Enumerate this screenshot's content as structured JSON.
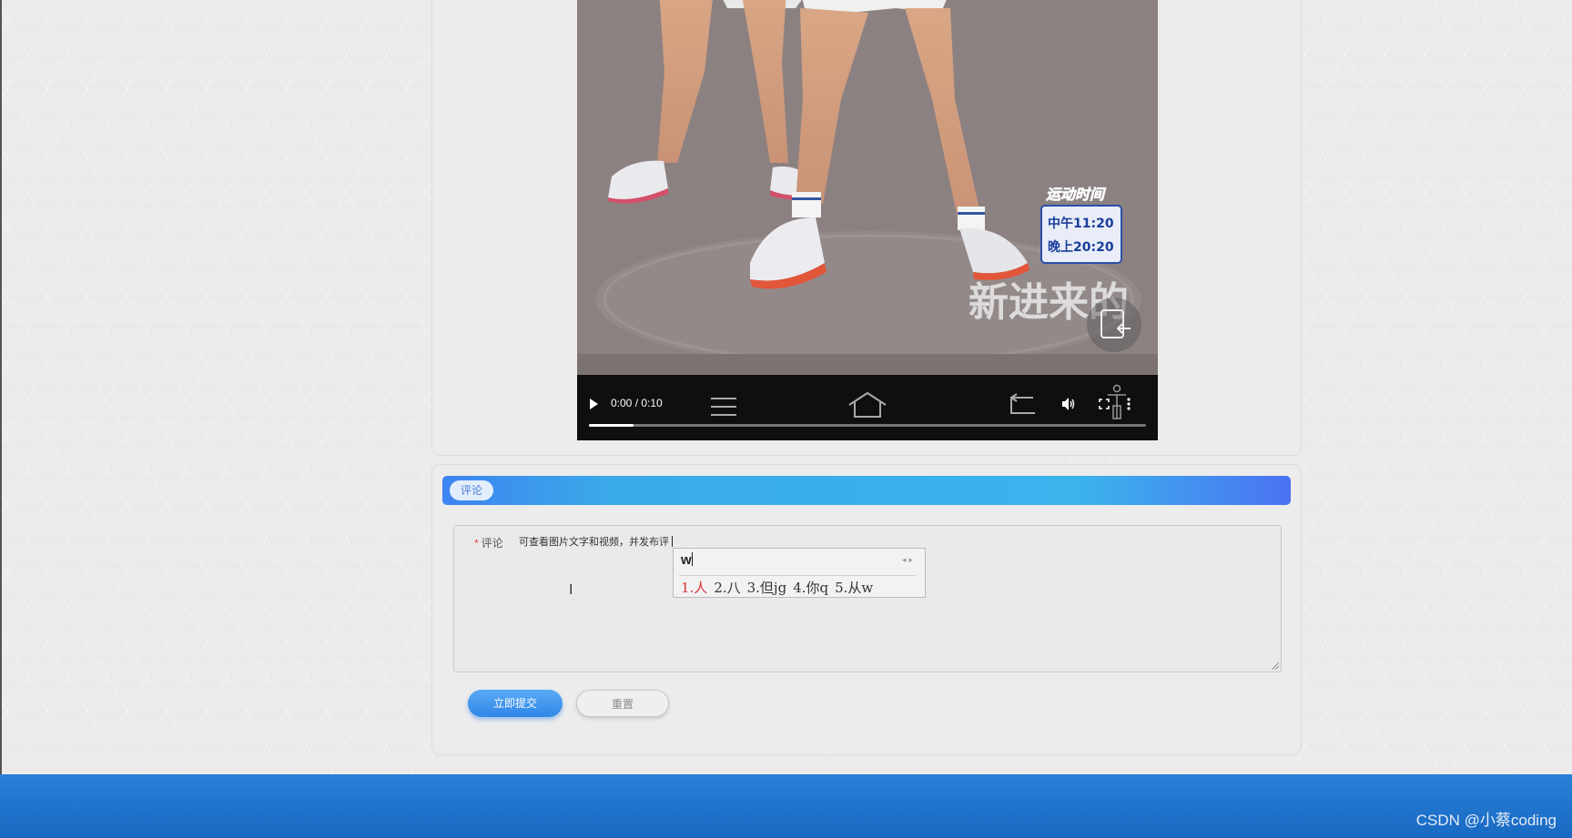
{
  "video": {
    "time": "0:00 / 0:10",
    "progress": 0.08,
    "overlay": {
      "badge_title": "运动时间",
      "badge_line1": "中午11:20",
      "badge_line2": "晚上20:20",
      "caption": "新进来的"
    }
  },
  "comment_section": {
    "header_label": "评论",
    "field_label": "评论",
    "required_mark": "*",
    "input_text": "可查看图片文字和视频，并发布评",
    "submit_label": "立即提交",
    "reset_label": "重置"
  },
  "ime": {
    "input": "w",
    "candidates": [
      "1.人",
      "2.八",
      "3.但jg",
      "4.你q",
      "5.从w"
    ]
  },
  "footer": {
    "watermark": "CSDN @小蔡coding"
  },
  "colors": {
    "header_gradient_start": "#3d84f0",
    "header_gradient_mid": "#3bb4ec",
    "submit": "#2f87e8",
    "footer": "#1f74cc",
    "required": "#e64545"
  }
}
